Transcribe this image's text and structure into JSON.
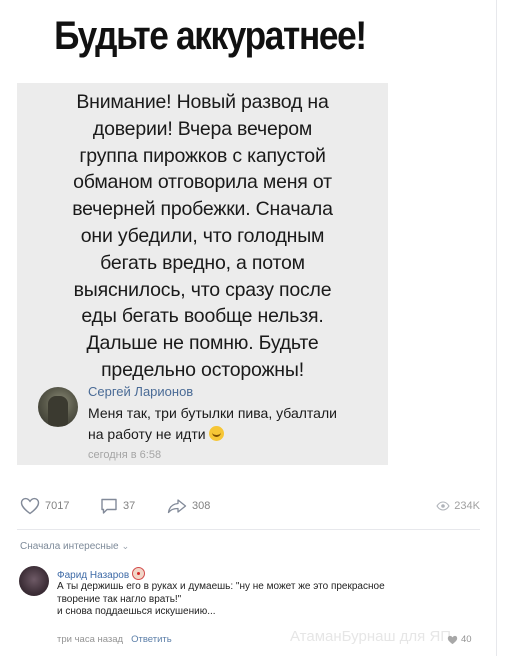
{
  "headline": "Будьте аккуратнее!",
  "image": {
    "warning_lines": [
      "Внимание! Новый развод на",
      "доверии! Вчера вечером",
      "группа пирожков с капустой",
      "обманом отговорила меня от",
      "вечерней пробежки. Сначала",
      "они убедили, что голодным",
      "бегать вредно, а потом",
      "выяснилось, что сразу после",
      "еды бегать вообще нельзя.",
      "Дальше не помню. Будьте",
      "предельно осторожны!"
    ],
    "comment": {
      "author": "Сергей Ларионов",
      "text_lines": [
        "Меня так, три бутылки пива, убалтали",
        "на работу не идти"
      ],
      "emoji": "rofl-emoji",
      "time": "сегодня в 6:58"
    }
  },
  "actions": {
    "likes": "7017",
    "comments": "37",
    "shares": "308",
    "views": "234K",
    "icons": [
      "heart-icon",
      "comment-icon",
      "share-icon",
      "eye-icon"
    ]
  },
  "comments_section": {
    "sort_label": "Сначала интересные",
    "reply": {
      "author": "Фарид Назаров",
      "author_badge": "clown-emoji",
      "text_lines": [
        "А ты держишь его в руках и думаешь: \"ну не может же это прекрасное",
        "творение так нагло врать!\"",
        "и снова поддаешься искушению..."
      ],
      "time": "три часа назад",
      "reply_label": "Ответить",
      "likes": "40"
    }
  },
  "watermark": "АтаманБурнаш для ЯП",
  "colors": {
    "link": "#3f6ba7",
    "muted": "#828282",
    "image_bg": "#ececec"
  }
}
